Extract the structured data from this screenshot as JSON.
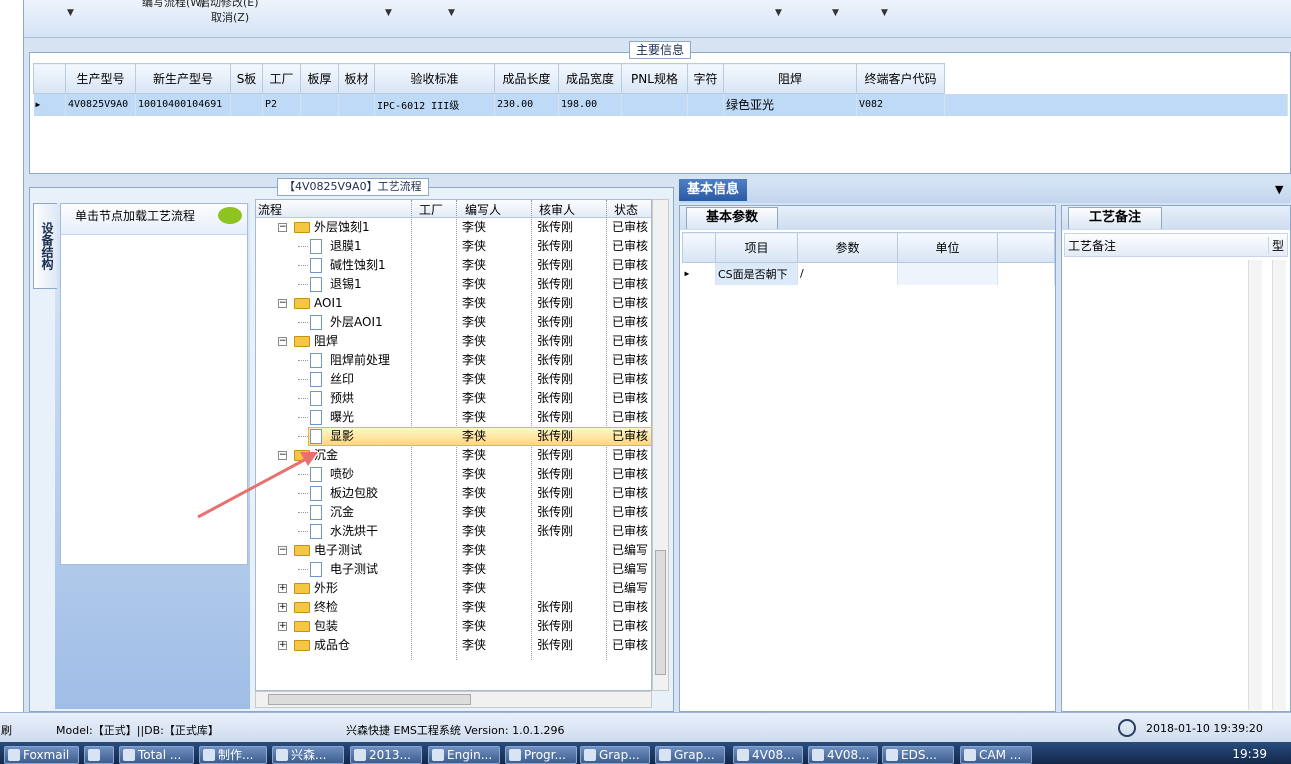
{
  "toolbar": {
    "item1": "编写流程(W)",
    "item2": "启动修改(E)",
    "cancel": "取消(Z)"
  },
  "main_info": {
    "title": "主要信息",
    "columns": [
      "生产型号",
      "新生产型号",
      "S板",
      "工厂",
      "板厚",
      "板材",
      "验收标准",
      "成品长度",
      "成品宽度",
      "PNL规格",
      "字符",
      "阻焊",
      "终端客户代码"
    ],
    "row": [
      "4V0825V9A0",
      "10010400104691",
      "",
      "P2",
      "",
      "",
      "IPC-6012 III级",
      "230.00",
      "198.00",
      "",
      "",
      "绿色亚光",
      "V082"
    ]
  },
  "flow_panel": {
    "title": "【4V0825V9A0】工艺流程",
    "side_tab": "设备结构",
    "nav_label": "单击节点加载工艺流程",
    "tree_header": {
      "flow": "流程",
      "factory": "工厂",
      "writer": "编写人",
      "auditor": "核审人",
      "state": "状态"
    },
    "rows": [
      {
        "name": "外层蚀刻1",
        "type": "folder",
        "writer": "李侠",
        "auditor": "张传刚",
        "state": "已审核"
      },
      {
        "name": "退膜1",
        "type": "doc",
        "writer": "李侠",
        "auditor": "张传刚",
        "state": "已审核"
      },
      {
        "name": "碱性蚀刻1",
        "type": "doc",
        "writer": "李侠",
        "auditor": "张传刚",
        "state": "已审核"
      },
      {
        "name": "退锡1",
        "type": "doc",
        "writer": "李侠",
        "auditor": "张传刚",
        "state": "已审核"
      },
      {
        "name": "AOI1",
        "type": "folder",
        "writer": "李侠",
        "auditor": "张传刚",
        "state": "已审核"
      },
      {
        "name": "外层AOI1",
        "type": "doc",
        "writer": "李侠",
        "auditor": "张传刚",
        "state": "已审核"
      },
      {
        "name": "阻焊",
        "type": "folder",
        "writer": "李侠",
        "auditor": "张传刚",
        "state": "已审核"
      },
      {
        "name": "阻焊前处理",
        "type": "doc",
        "writer": "李侠",
        "auditor": "张传刚",
        "state": "已审核"
      },
      {
        "name": "丝印",
        "type": "doc",
        "writer": "李侠",
        "auditor": "张传刚",
        "state": "已审核"
      },
      {
        "name": "预烘",
        "type": "doc",
        "writer": "李侠",
        "auditor": "张传刚",
        "state": "已审核"
      },
      {
        "name": "曝光",
        "type": "doc",
        "writer": "李侠",
        "auditor": "张传刚",
        "state": "已审核"
      },
      {
        "name": "显影",
        "type": "doc",
        "writer": "李侠",
        "auditor": "张传刚",
        "state": "已审核"
      },
      {
        "name": "沉金",
        "type": "folder",
        "writer": "李侠",
        "auditor": "张传刚",
        "state": "已审核"
      },
      {
        "name": "喷砂",
        "type": "doc",
        "writer": "李侠",
        "auditor": "张传刚",
        "state": "已审核"
      },
      {
        "name": "板边包胶",
        "type": "doc",
        "writer": "李侠",
        "auditor": "张传刚",
        "state": "已审核"
      },
      {
        "name": "沉金",
        "type": "doc",
        "writer": "李侠",
        "auditor": "张传刚",
        "state": "已审核"
      },
      {
        "name": "水洗烘干",
        "type": "doc",
        "writer": "李侠",
        "auditor": "张传刚",
        "state": "已审核"
      },
      {
        "name": "电子测试",
        "type": "folder",
        "writer": "李侠",
        "auditor": "",
        "state": "已编写"
      },
      {
        "name": "电子测试",
        "type": "doc",
        "writer": "李侠",
        "auditor": "",
        "state": "已编写"
      },
      {
        "name": "外形",
        "type": "folder",
        "writer": "李侠",
        "auditor": "",
        "state": "已编写"
      },
      {
        "name": "终检",
        "type": "folder",
        "writer": "李侠",
        "auditor": "张传刚",
        "state": "已审核"
      },
      {
        "name": "包装",
        "type": "folder",
        "writer": "李侠",
        "auditor": "张传刚",
        "state": "已审核"
      },
      {
        "name": "成品仓",
        "type": "folder",
        "writer": "李侠",
        "auditor": "张传刚",
        "state": "已审核"
      }
    ]
  },
  "basic_info": {
    "tab": "基本信息",
    "sub_tab": "基本参数",
    "columns": [
      "项目",
      "参数",
      "单位"
    ],
    "row": [
      "CS面是否朝下",
      "/",
      ""
    ]
  },
  "remarks": {
    "tab": "工艺备注",
    "col1": "工艺备注",
    "col2": "型"
  },
  "status": {
    "left": "刷",
    "model": "Model:【正式】||DB:【正式库】",
    "system": "兴森快捷 EMS工程系统 Version: 1.0.1.296",
    "datetime": "2018-01-10 19:39:20"
  },
  "taskbar": {
    "items": [
      "Foxmail",
      "",
      "Total ...",
      "制作...",
      "兴森...",
      "2013...",
      "Engin...",
      "Progr...",
      "Grap...",
      "Grap...",
      "4V08...",
      "4V08...",
      "EDS...",
      "CAM ..."
    ],
    "clock": "19:39"
  }
}
